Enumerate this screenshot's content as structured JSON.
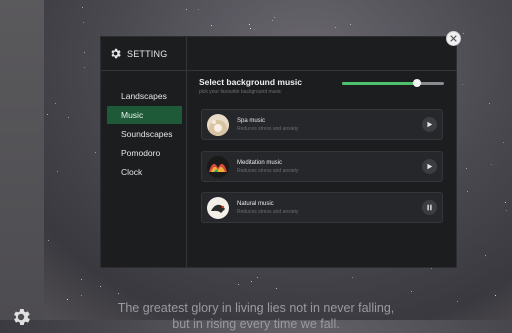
{
  "settings": {
    "title": "SETTING",
    "menu": [
      {
        "label": "Landscapes"
      },
      {
        "label": "Music"
      },
      {
        "label": "Soundscapes"
      },
      {
        "label": "Pomodoro"
      },
      {
        "label": "Clock"
      }
    ],
    "active_menu": "Music"
  },
  "music": {
    "title": "Select background music",
    "subtitle": "pick your favourite background music",
    "volume": 0.74,
    "tracks": [
      {
        "name": "Spa music",
        "description": "Reduces stress and anxiety",
        "state": "play"
      },
      {
        "name": "Meditation music",
        "description": "Reduces stress and anxiety",
        "state": "play"
      },
      {
        "name": "Natural music",
        "description": "Reduces stress and anxiety",
        "state": "pause"
      }
    ]
  },
  "background": {
    "quote_line1": "The greatest glory in living lies not in never falling,",
    "quote_line2": "but in rising every time we fall."
  },
  "colors": {
    "accent": "#4cc06a",
    "active_bg": "#1e5a38",
    "panel": "#1c1d1f"
  },
  "icons": {
    "settings": "gear-icon",
    "close": "close-icon",
    "play": "play-icon",
    "pause": "pause-icon"
  }
}
